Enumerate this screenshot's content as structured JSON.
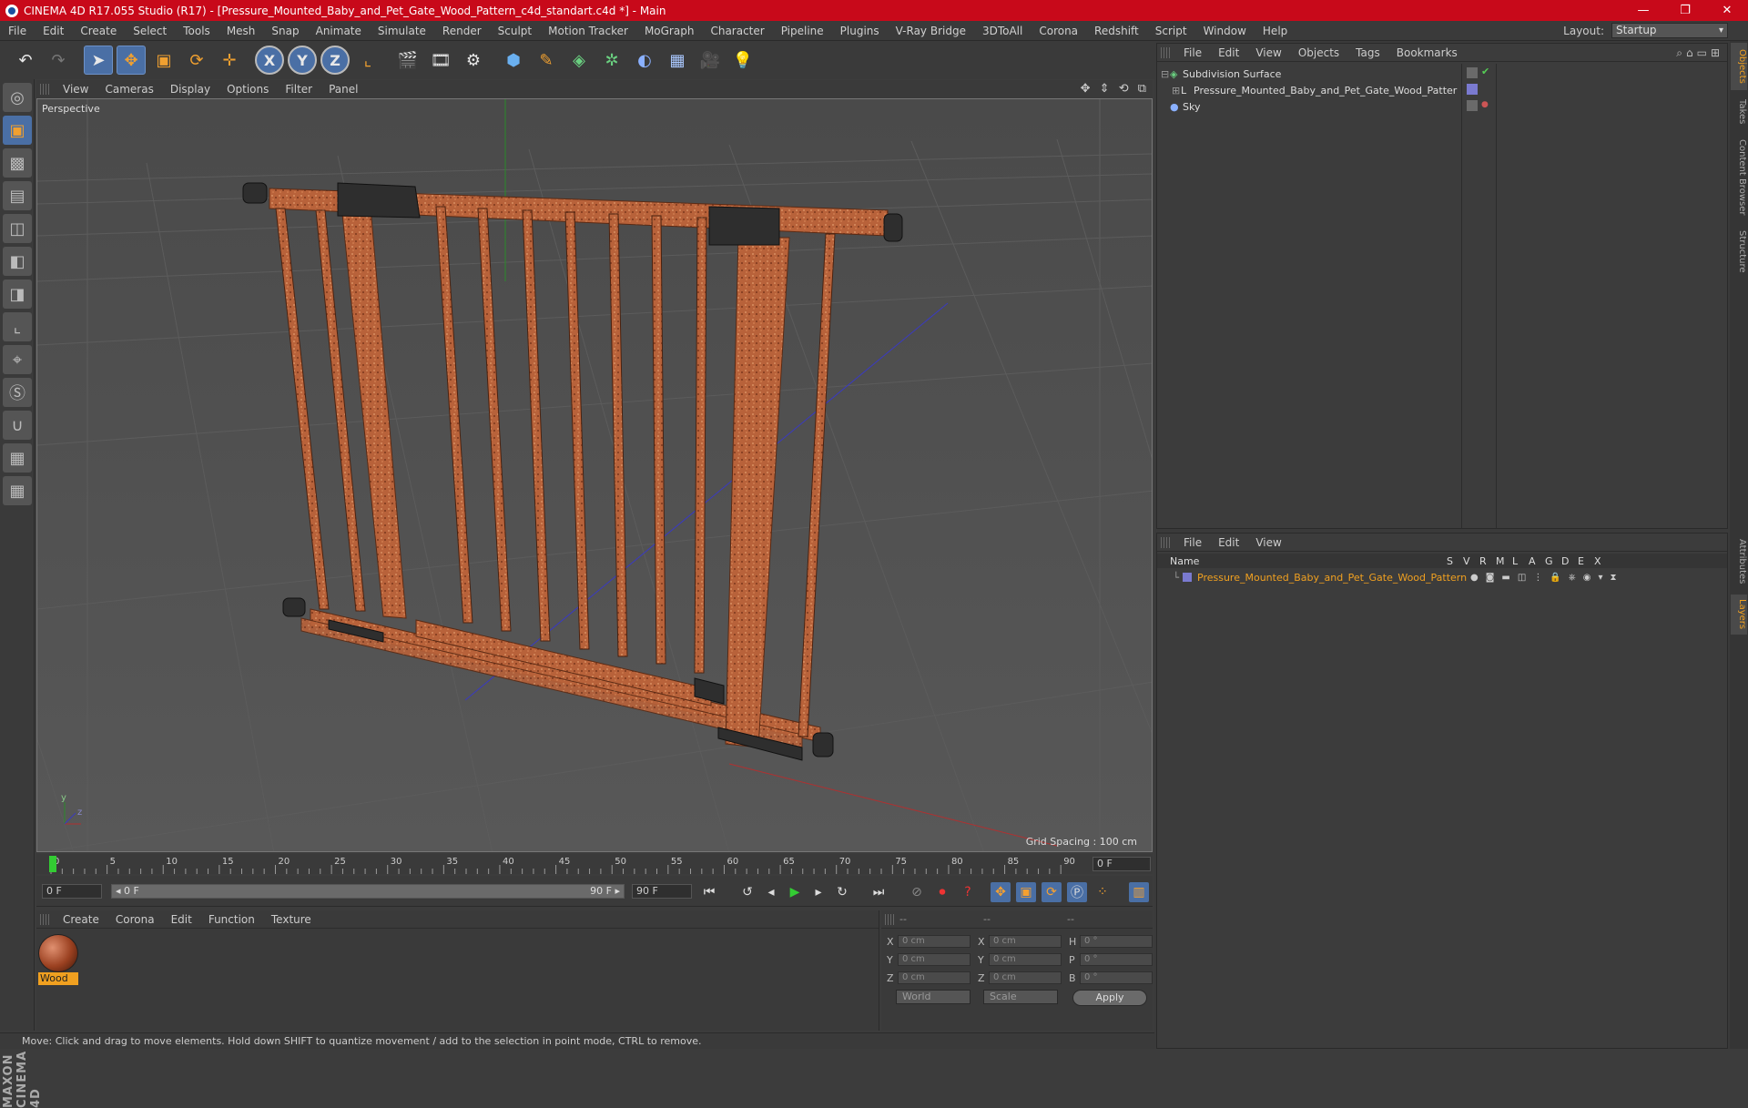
{
  "window": {
    "title": "CINEMA 4D R17.055 Studio (R17) - [Pressure_Mounted_Baby_and_Pet_Gate_Wood_Pattern_c4d_standart.c4d *] - Main",
    "minimize": "—",
    "maximize": "❐",
    "close": "✕"
  },
  "menubar": [
    "File",
    "Edit",
    "Create",
    "Select",
    "Tools",
    "Mesh",
    "Snap",
    "Animate",
    "Simulate",
    "Render",
    "Sculpt",
    "Motion Tracker",
    "MoGraph",
    "Character",
    "Pipeline",
    "Plugins",
    "V-Ray Bridge",
    "3DToAll",
    "Corona",
    "Redshift",
    "Script",
    "Window",
    "Help"
  ],
  "layout": {
    "label": "Layout:",
    "value": "Startup"
  },
  "toolbar": {
    "undo": "↶",
    "redo": "↷",
    "select": "➤",
    "move": "✥",
    "scale": "▣",
    "rotate": "⟳",
    "last": "✛",
    "x": "X",
    "y": "Y",
    "z": "Z",
    "coord": "⌞",
    "render_view": "🎬",
    "render_pv": "🎞",
    "render_settings": "⚙",
    "cube": "⬢",
    "pen": "✎",
    "nurbs": "◈",
    "array": "✲",
    "deformer": "◐",
    "floor": "▦",
    "camera": "🎥",
    "light": "💡"
  },
  "viewport": {
    "menu": [
      "View",
      "Cameras",
      "Display",
      "Options",
      "Filter",
      "Panel"
    ],
    "nav_icons": "✥ ⇕ ⟲ ⧉",
    "label": "Perspective",
    "grid_spacing": "Grid Spacing : 100 cm",
    "axis_y": "y",
    "axis_z": "z",
    "axis_x": "x"
  },
  "timeline": {
    "ticks": [
      "0",
      "5",
      "10",
      "15",
      "20",
      "25",
      "30",
      "35",
      "40",
      "45",
      "50",
      "55",
      "60",
      "65",
      "70",
      "75",
      "80",
      "85",
      "90"
    ],
    "current_frame": "0 F"
  },
  "transport": {
    "start": "0 F",
    "slider_left": "◂ 0 F",
    "slider_right": "90 F ▸",
    "end": "90 F"
  },
  "material_panel": {
    "menu": [
      "Create",
      "Corona",
      "Edit",
      "Function",
      "Texture"
    ],
    "material_name": "Wood"
  },
  "coord_panel": {
    "headers": [
      "--",
      "--",
      "--"
    ],
    "rows": [
      {
        "l1": "X",
        "v1": "0 cm",
        "l2": "X",
        "v2": "0 cm",
        "l3": "H",
        "v3": "0 °"
      },
      {
        "l1": "Y",
        "v1": "0 cm",
        "l2": "Y",
        "v2": "0 cm",
        "l3": "P",
        "v3": "0 °"
      },
      {
        "l1": "Z",
        "v1": "0 cm",
        "l2": "Z",
        "v2": "0 cm",
        "l3": "B",
        "v3": "0 °"
      }
    ],
    "mode1": "World",
    "mode2": "Scale",
    "apply": "Apply"
  },
  "status": "Move: Click and drag to move elements. Hold down SHIFT to quantize movement / add to the selection in point mode, CTRL to remove.",
  "object_manager": {
    "menu": [
      "File",
      "Edit",
      "View",
      "Objects",
      "Tags",
      "Bookmarks"
    ],
    "objects": [
      {
        "name": "Subdivision Surface"
      },
      {
        "name": "Pressure_Mounted_Baby_and_Pet_Gate_Wood_Pattern"
      },
      {
        "name": "Sky"
      }
    ]
  },
  "layer_manager": {
    "menu": [
      "File",
      "Edit",
      "View"
    ],
    "columns": [
      "Name",
      "S",
      "V",
      "R",
      "M",
      "L",
      "A",
      "G",
      "D",
      "E",
      "X"
    ],
    "layer_name": "Pressure_Mounted_Baby_and_Pet_Gate_Wood_Pattern"
  },
  "side_tabs": [
    "Objects",
    "Takes",
    "Content Browser",
    "Structure",
    "Attributes",
    "Layers"
  ],
  "colors": {
    "title_bar": "#c8091a",
    "accent": "#4a6fa5",
    "selected": "#f0a020"
  }
}
